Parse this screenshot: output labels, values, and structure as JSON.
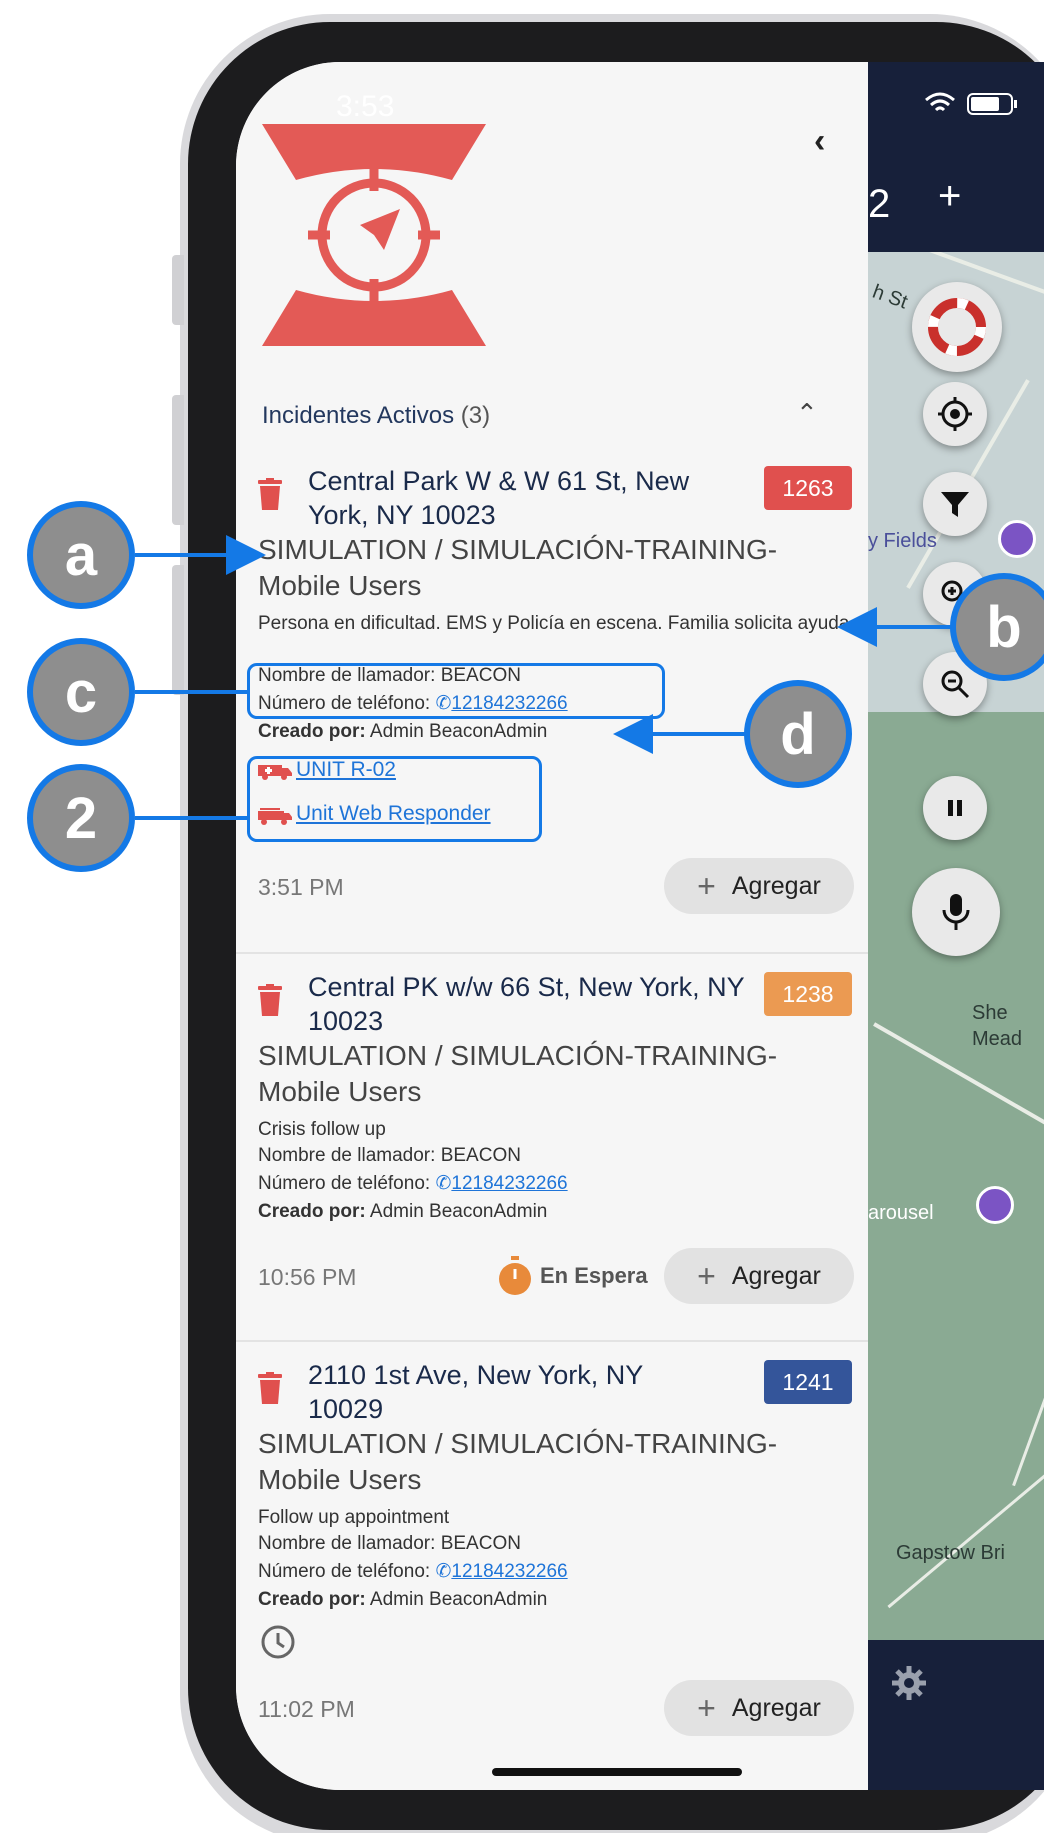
{
  "status_bar": {
    "time": "3:53"
  },
  "drawer": {
    "section_title": "Incidentes Activos",
    "section_count": "(3)",
    "back_icon": "chevron-left-icon"
  },
  "incidents": [
    {
      "address": "Central Park W & W 61 St, New York, NY 10023",
      "badge": "1263",
      "badge_color": "#e0504e",
      "type": "SIMULATION / SIMULACIÓN-TRAINING-Mobile Users",
      "description": "Persona en dificultad. EMS y Policía en escena. Familia solicita ayuda.",
      "caller_label": "Nombre de llamador:",
      "caller": "BEACON",
      "phone_label": "Número de teléfono:",
      "phone": "12184232266",
      "created_label": "Creado por:",
      "created_by": "Admin BeaconAdmin",
      "units": [
        "UNIT R-02",
        "Unit Web Responder"
      ],
      "time": "3:51 PM",
      "add_label": "Agregar"
    },
    {
      "address": "Central PK w/w 66 St, New York, NY 10023",
      "badge": "1238",
      "badge_color": "#eb9a52",
      "type": "SIMULATION / SIMULACIÓN-TRAINING-Mobile Users",
      "description": "Crisis follow up",
      "caller_label": "Nombre de llamador:",
      "caller": "BEACON",
      "phone_label": "Número de teléfono:",
      "phone": "12184232266",
      "created_label": "Creado por:",
      "created_by": "Admin BeaconAdmin",
      "status": "En Espera",
      "time": "10:56 PM",
      "add_label": "Agregar"
    },
    {
      "address": "2110 1st Ave, New York, NY 10029",
      "badge": "1241",
      "badge_color": "#34559a",
      "type": "SIMULATION / SIMULACIÓN-TRAINING-Mobile Users",
      "description": "Follow up appointment",
      "caller_label": "Nombre de llamador:",
      "caller": "BEACON",
      "phone_label": "Número de teléfono:",
      "phone": "12184232266",
      "created_label": "Creado por:",
      "created_by": "Admin BeaconAdmin",
      "time": "11:02 PM",
      "add_label": "Agregar"
    }
  ],
  "map": {
    "labels": [
      "y Fields",
      "She",
      "Mead",
      "arousel",
      "Gapstow Bri",
      "h St"
    ],
    "header_plus": "+",
    "header_partial": "2"
  },
  "annotations": [
    "a",
    "b",
    "c",
    "d",
    "2"
  ],
  "colors": {
    "accent_link": "#1e74d8",
    "annotation_blue": "#1479e6",
    "logo_red": "#e35a56"
  }
}
